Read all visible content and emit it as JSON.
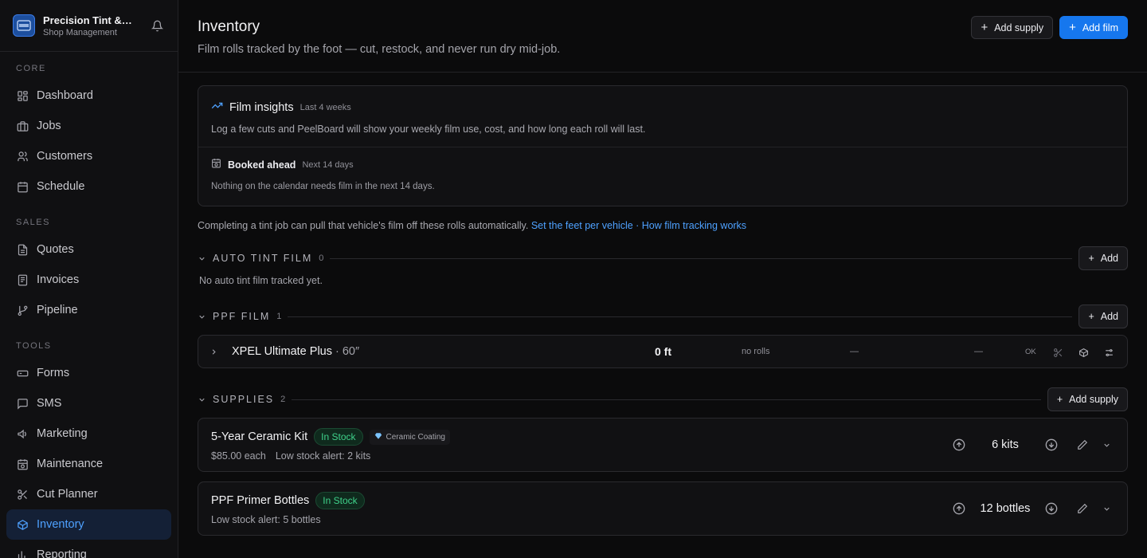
{
  "brand": {
    "name": "Precision Tint & Wrap",
    "subtitle": "Shop Management"
  },
  "nav": {
    "sections": [
      {
        "label": "CORE",
        "items": [
          {
            "label": "Dashboard",
            "icon": "grid-icon"
          },
          {
            "label": "Jobs",
            "icon": "briefcase-icon"
          },
          {
            "label": "Customers",
            "icon": "users-icon"
          },
          {
            "label": "Schedule",
            "icon": "calendar-icon"
          }
        ]
      },
      {
        "label": "SALES",
        "items": [
          {
            "label": "Quotes",
            "icon": "file-icon"
          },
          {
            "label": "Invoices",
            "icon": "receipt-icon"
          },
          {
            "label": "Pipeline",
            "icon": "git-branch-icon"
          }
        ]
      },
      {
        "label": "TOOLS",
        "items": [
          {
            "label": "Forms",
            "icon": "form-icon"
          },
          {
            "label": "SMS",
            "icon": "message-icon"
          },
          {
            "label": "Marketing",
            "icon": "megaphone-icon"
          },
          {
            "label": "Maintenance",
            "icon": "calendar-clock-icon"
          },
          {
            "label": "Cut Planner",
            "icon": "scissors-icon"
          },
          {
            "label": "Inventory",
            "icon": "box-icon",
            "active": true
          },
          {
            "label": "Reporting",
            "icon": "bar-chart-icon"
          }
        ]
      }
    ]
  },
  "header": {
    "title": "Inventory",
    "subtitle": "Film rolls tracked by the foot — cut, restock, and never run dry mid-job.",
    "add_supply": "Add supply",
    "add_film": "Add film"
  },
  "insights": {
    "title": "Film insights",
    "period": "Last 4 weeks",
    "body": "Log a few cuts and PeelBoard will show your weekly film use, cost, and how long each roll will last.",
    "ahead_title": "Booked ahead",
    "ahead_period": "Next 14 days",
    "ahead_body": "Nothing on the calendar needs film in the next 14 days."
  },
  "note": {
    "text": "Completing a tint job can pull that vehicle's film off these rolls automatically.",
    "link1": "Set the feet per vehicle",
    "sep": " · ",
    "link2": "How film tracking works"
  },
  "auto_tint": {
    "title": "AUTO TINT FILM",
    "count": "0",
    "add": "Add",
    "empty": "No auto tint film tracked yet."
  },
  "ppf": {
    "title": "PPF FILM",
    "count": "1",
    "add": "Add",
    "rows": [
      {
        "name": "XPEL Ultimate Plus",
        "width": " · 60″",
        "feet": "0 ft",
        "rolls": "no rolls",
        "col1": "—",
        "col2": "—",
        "status": "OK"
      }
    ]
  },
  "supplies": {
    "title": "SUPPLIES",
    "count": "2",
    "add": "Add supply",
    "items": [
      {
        "name": "5-Year Ceramic Kit",
        "badge": "In Stock",
        "tag": "Ceramic Coating",
        "price": "$85.00 each",
        "alert": "Low stock alert: 2 kits",
        "qty": "6 kits"
      },
      {
        "name": "PPF Primer Bottles",
        "badge": "In Stock",
        "alert": "Low stock alert: 5 bottles",
        "qty": "12 bottles"
      }
    ]
  }
}
